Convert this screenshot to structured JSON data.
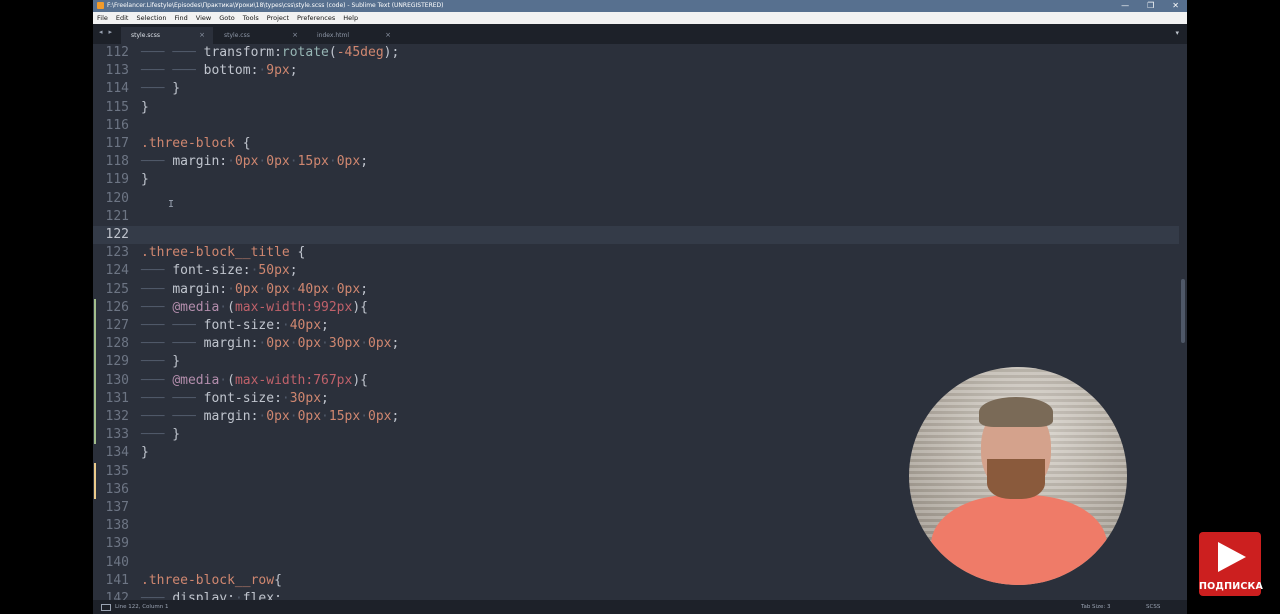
{
  "window": {
    "title": "F:\\Freelancer.Lifestyle\\Episodes\\Практика\\Уроки\\18\\types\\css\\style.scss (code) - Sublime Text (UNREGISTERED)",
    "controls": [
      "—",
      "❐",
      "✕"
    ]
  },
  "menu": [
    "File",
    "Edit",
    "Selection",
    "Find",
    "View",
    "Goto",
    "Tools",
    "Project",
    "Preferences",
    "Help"
  ],
  "tabs": [
    {
      "label": "style.scss",
      "active": true
    },
    {
      "label": "style.css",
      "active": false
    },
    {
      "label": "index.html",
      "active": false
    }
  ],
  "tab_nav": {
    "prev": "◂",
    "next": "▸",
    "dropdown": "▾",
    "close": "×"
  },
  "editor": {
    "current_line": 122,
    "lines": [
      {
        "n": "112",
        "code": "        transform:rotate(-45deg);"
      },
      {
        "n": "113",
        "code": "        bottom: 9px;"
      },
      {
        "n": "114",
        "code": "    }"
      },
      {
        "n": "115",
        "code": "}"
      },
      {
        "n": "116",
        "code": ""
      },
      {
        "n": "117",
        "code": ".three-block {"
      },
      {
        "n": "118",
        "code": "    margin: 0px 0px 15px 0px;"
      },
      {
        "n": "119",
        "code": "}"
      },
      {
        "n": "120",
        "code": ""
      },
      {
        "n": "121",
        "code": ""
      },
      {
        "n": "122",
        "code": ""
      },
      {
        "n": "123",
        "code": ".three-block__title {"
      },
      {
        "n": "124",
        "code": "    font-size: 50px;"
      },
      {
        "n": "125",
        "code": "    margin: 0px 0px 40px 0px;"
      },
      {
        "n": "126",
        "code": "    @media (max-width:992px){"
      },
      {
        "n": "127",
        "code": "        font-size: 40px;"
      },
      {
        "n": "128",
        "code": "        margin: 0px 0px 30px 0px;"
      },
      {
        "n": "129",
        "code": "    }"
      },
      {
        "n": "130",
        "code": "    @media (max-width:767px){"
      },
      {
        "n": "131",
        "code": "        font-size: 30px;"
      },
      {
        "n": "132",
        "code": "        margin: 0px 0px 15px 0px;"
      },
      {
        "n": "133",
        "code": "    }"
      },
      {
        "n": "134",
        "code": "}"
      },
      {
        "n": "135",
        "code": ""
      },
      {
        "n": "136",
        "code": ""
      },
      {
        "n": "137",
        "code": ""
      },
      {
        "n": "138",
        "code": ""
      },
      {
        "n": "139",
        "code": ""
      },
      {
        "n": "140",
        "code": ""
      },
      {
        "n": "141",
        "code": ".three-block__row{"
      },
      {
        "n": "142",
        "code": "    display: flex;"
      }
    ],
    "added_lines": [
      "126",
      "127",
      "128",
      "129",
      "130",
      "131",
      "132",
      "133"
    ],
    "modified_lines": [
      "135",
      "136"
    ]
  },
  "status": {
    "position": "Line 122, Column 1",
    "tab_size": "Tab Size: 3",
    "syntax": "SCSS"
  },
  "subscribe": {
    "label": "ПОДПИСКА"
  },
  "colors": {
    "editor_bg": "#2b303b",
    "selector": "#d08770",
    "number": "#d08770",
    "function": "#96b5b4",
    "media_query": "#bf616a",
    "at_rule": "#b48ead",
    "subscribe_bg": "#cc1f1f"
  }
}
